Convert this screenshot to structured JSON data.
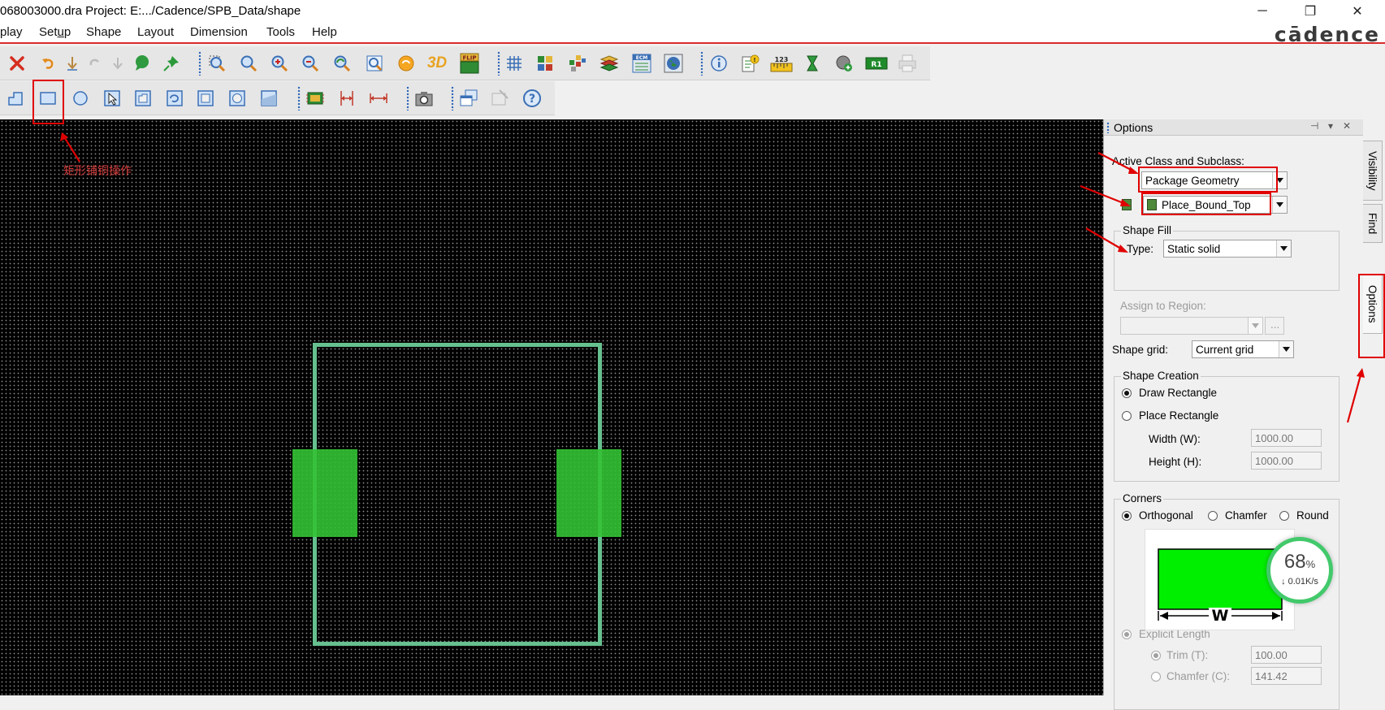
{
  "window": {
    "title": "068003000.dra  Project: E:.../Cadence/SPB_Data/shape",
    "minimize": "─",
    "restore": "❐",
    "close": "✕"
  },
  "brand": {
    "logo": "cādence"
  },
  "menu": [
    {
      "label": "play",
      "acc": ""
    },
    {
      "label": "Setup",
      "acc": "u"
    },
    {
      "label": "Shape",
      "acc": "S"
    },
    {
      "label": "Layout",
      "acc": "L"
    },
    {
      "label": "Dimension",
      "acc": "D"
    },
    {
      "label": "Tools",
      "acc": "T"
    },
    {
      "label": "Help",
      "acc": "H"
    }
  ],
  "toolbar": {
    "flip_label": "FLIP",
    "three_d_label": "3D",
    "numbers_label": "123",
    "ecm_label": "ECM",
    "r1_label": "R1"
  },
  "canvas": {
    "annotation": "矩形铺铜操作"
  },
  "options_panel": {
    "title": "Options",
    "active_class_label": "Active Class and Subclass:",
    "class_value": "Package Geometry",
    "subclass_value": "Place_Bound_Top",
    "subclass_color": "#4f8a3b",
    "shape_fill": {
      "title": "Shape Fill",
      "type_label": "Type:",
      "type_value": "Static solid"
    },
    "assign_region_label": "Assign to Region:",
    "assign_region_value": "",
    "assign_region_button": "...",
    "shape_grid_label": "Shape grid:",
    "shape_grid_value": "Current grid",
    "shape_creation": {
      "title": "Shape Creation",
      "draw_rectangle": "Draw Rectangle",
      "place_rectangle": "Place Rectangle",
      "width_label": "Width (W):",
      "width_value": "1000.00",
      "height_label": "Height (H):",
      "height_value": "1000.00"
    },
    "corners": {
      "title": "Corners",
      "orthogonal": "Orthogonal",
      "chamfer": "Chamfer",
      "round": "Round",
      "preview_w_label": "W",
      "explicit_length": "Explicit Length",
      "trim_label": "Trim (T):",
      "trim_value": "100.00",
      "chamfer_label": "Chamfer (C):",
      "chamfer_value": "141.42"
    }
  },
  "side_tabs": [
    "Visibility",
    "Find",
    "Options"
  ],
  "net_meter": {
    "percent": "68",
    "percent_unit": "%",
    "rate": "0.01K/s",
    "rate_arrow": "↓"
  }
}
